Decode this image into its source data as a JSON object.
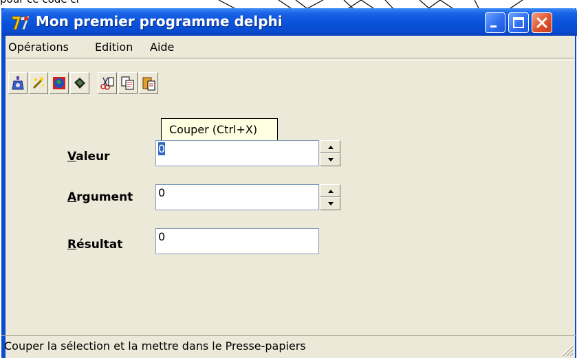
{
  "window": {
    "title": "Mon premier programme delphi",
    "icon": "delphi-app-icon"
  },
  "titlebar_buttons": {
    "minimize_icon": "minimize-icon",
    "maximize_icon": "maximize-icon",
    "close_icon": "close-icon"
  },
  "menu": {
    "items": [
      {
        "label": "Opérations"
      },
      {
        "label": "Edition"
      },
      {
        "label": "Aide"
      }
    ]
  },
  "toolbar": {
    "buttons": [
      {
        "icon": "calculate-icon"
      },
      {
        "icon": "wizard-icon"
      },
      {
        "icon": "globe-icon"
      },
      {
        "icon": "chip-icon"
      },
      {
        "icon": "cut-icon"
      },
      {
        "icon": "copy-icon"
      },
      {
        "icon": "paste-icon"
      }
    ]
  },
  "tooltip": {
    "text": "Couper (Ctrl+X)"
  },
  "form": {
    "valeur": {
      "label_hotkey": "V",
      "label_rest": "aleur",
      "value": "0"
    },
    "argument": {
      "label_hotkey": "A",
      "label_rest": "rgument",
      "value": "0"
    },
    "resultat": {
      "label_hotkey": "R",
      "label_rest": "ésultat",
      "value": "0"
    }
  },
  "statusbar": {
    "text": "Couper la sélection et la mettre dans le Presse-papiers"
  },
  "background": {
    "fragment_text": "pour ce code ci"
  },
  "colors": {
    "titlebar": "#0a54dc",
    "window_bg": "#ece9d8",
    "close_button": "#e0512a",
    "tooltip_bg": "#ffffe1",
    "selection": "#316ac5"
  }
}
